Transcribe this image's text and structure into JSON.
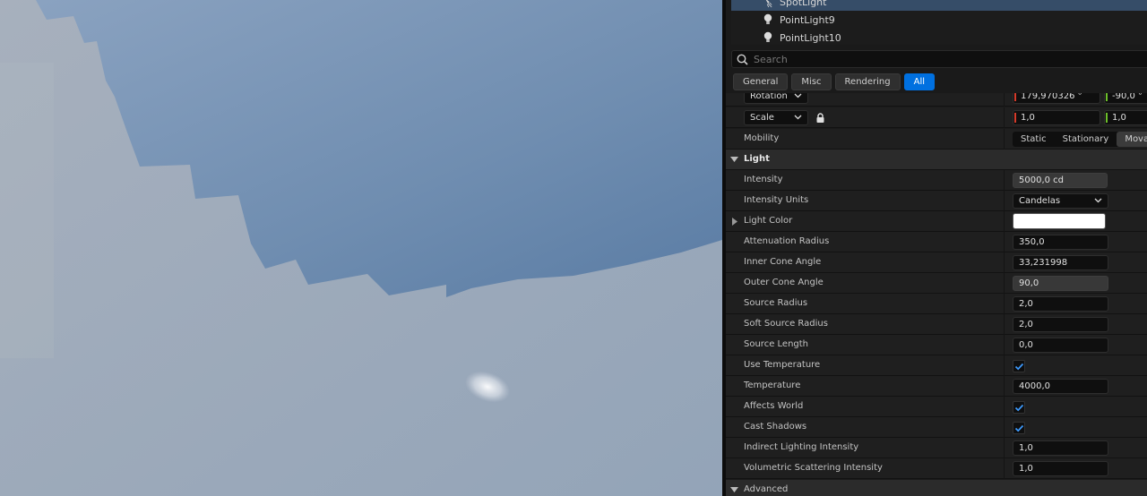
{
  "outliner": {
    "items": [
      {
        "label": "SpotLight",
        "icon": "spotlight-icon",
        "selected": true
      },
      {
        "label": "PointLight9",
        "icon": "pointlight-icon",
        "selected": false
      },
      {
        "label": "PointLight10",
        "icon": "pointlight-icon",
        "selected": false
      }
    ]
  },
  "search": {
    "placeholder": "Search",
    "value": ""
  },
  "filters": [
    {
      "label": "General",
      "active": false
    },
    {
      "label": "Misc",
      "active": false
    },
    {
      "label": "Rendering",
      "active": false
    },
    {
      "label": "All",
      "active": true
    }
  ],
  "transform": {
    "rotation": {
      "label": "Rotation",
      "x": "179,970326 °",
      "y": "-90,0 °"
    },
    "scale": {
      "label": "Scale",
      "x": "1,0",
      "y": "1,0"
    }
  },
  "mobility": {
    "label": "Mobility",
    "options": [
      "Static",
      "Stationary",
      "Movable"
    ],
    "selected": "Movable"
  },
  "light_section": {
    "title": "Light"
  },
  "properties": {
    "intensity": {
      "label": "Intensity",
      "value": "5000,0 cd"
    },
    "intensity_units": {
      "label": "Intensity Units",
      "value": "Candelas"
    },
    "light_color": {
      "label": "Light Color",
      "value": "#ffffff"
    },
    "attenuation_radius": {
      "label": "Attenuation Radius",
      "value": "350,0"
    },
    "inner_cone_angle": {
      "label": "Inner Cone Angle",
      "value": "33,231998"
    },
    "outer_cone_angle": {
      "label": "Outer Cone Angle",
      "value": "90,0"
    },
    "source_radius": {
      "label": "Source Radius",
      "value": "2,0"
    },
    "soft_source_radius": {
      "label": "Soft Source Radius",
      "value": "2,0"
    },
    "source_length": {
      "label": "Source Length",
      "value": "0,0"
    },
    "use_temperature": {
      "label": "Use Temperature",
      "checked": true
    },
    "temperature": {
      "label": "Temperature",
      "value": "4000,0"
    },
    "affects_world": {
      "label": "Affects World",
      "checked": true
    },
    "cast_shadows": {
      "label": "Cast Shadows",
      "checked": true
    },
    "indirect_lighting_intensity": {
      "label": "Indirect Lighting Intensity",
      "value": "1,0"
    },
    "volumetric_scattering_intensity": {
      "label": "Volumetric Scattering Intensity",
      "value": "1,0"
    }
  },
  "advanced_section": {
    "title": "Advanced"
  },
  "colors": {
    "accent": "#0070e0",
    "selection": "#364d68",
    "panel": "#1a1a1a"
  }
}
